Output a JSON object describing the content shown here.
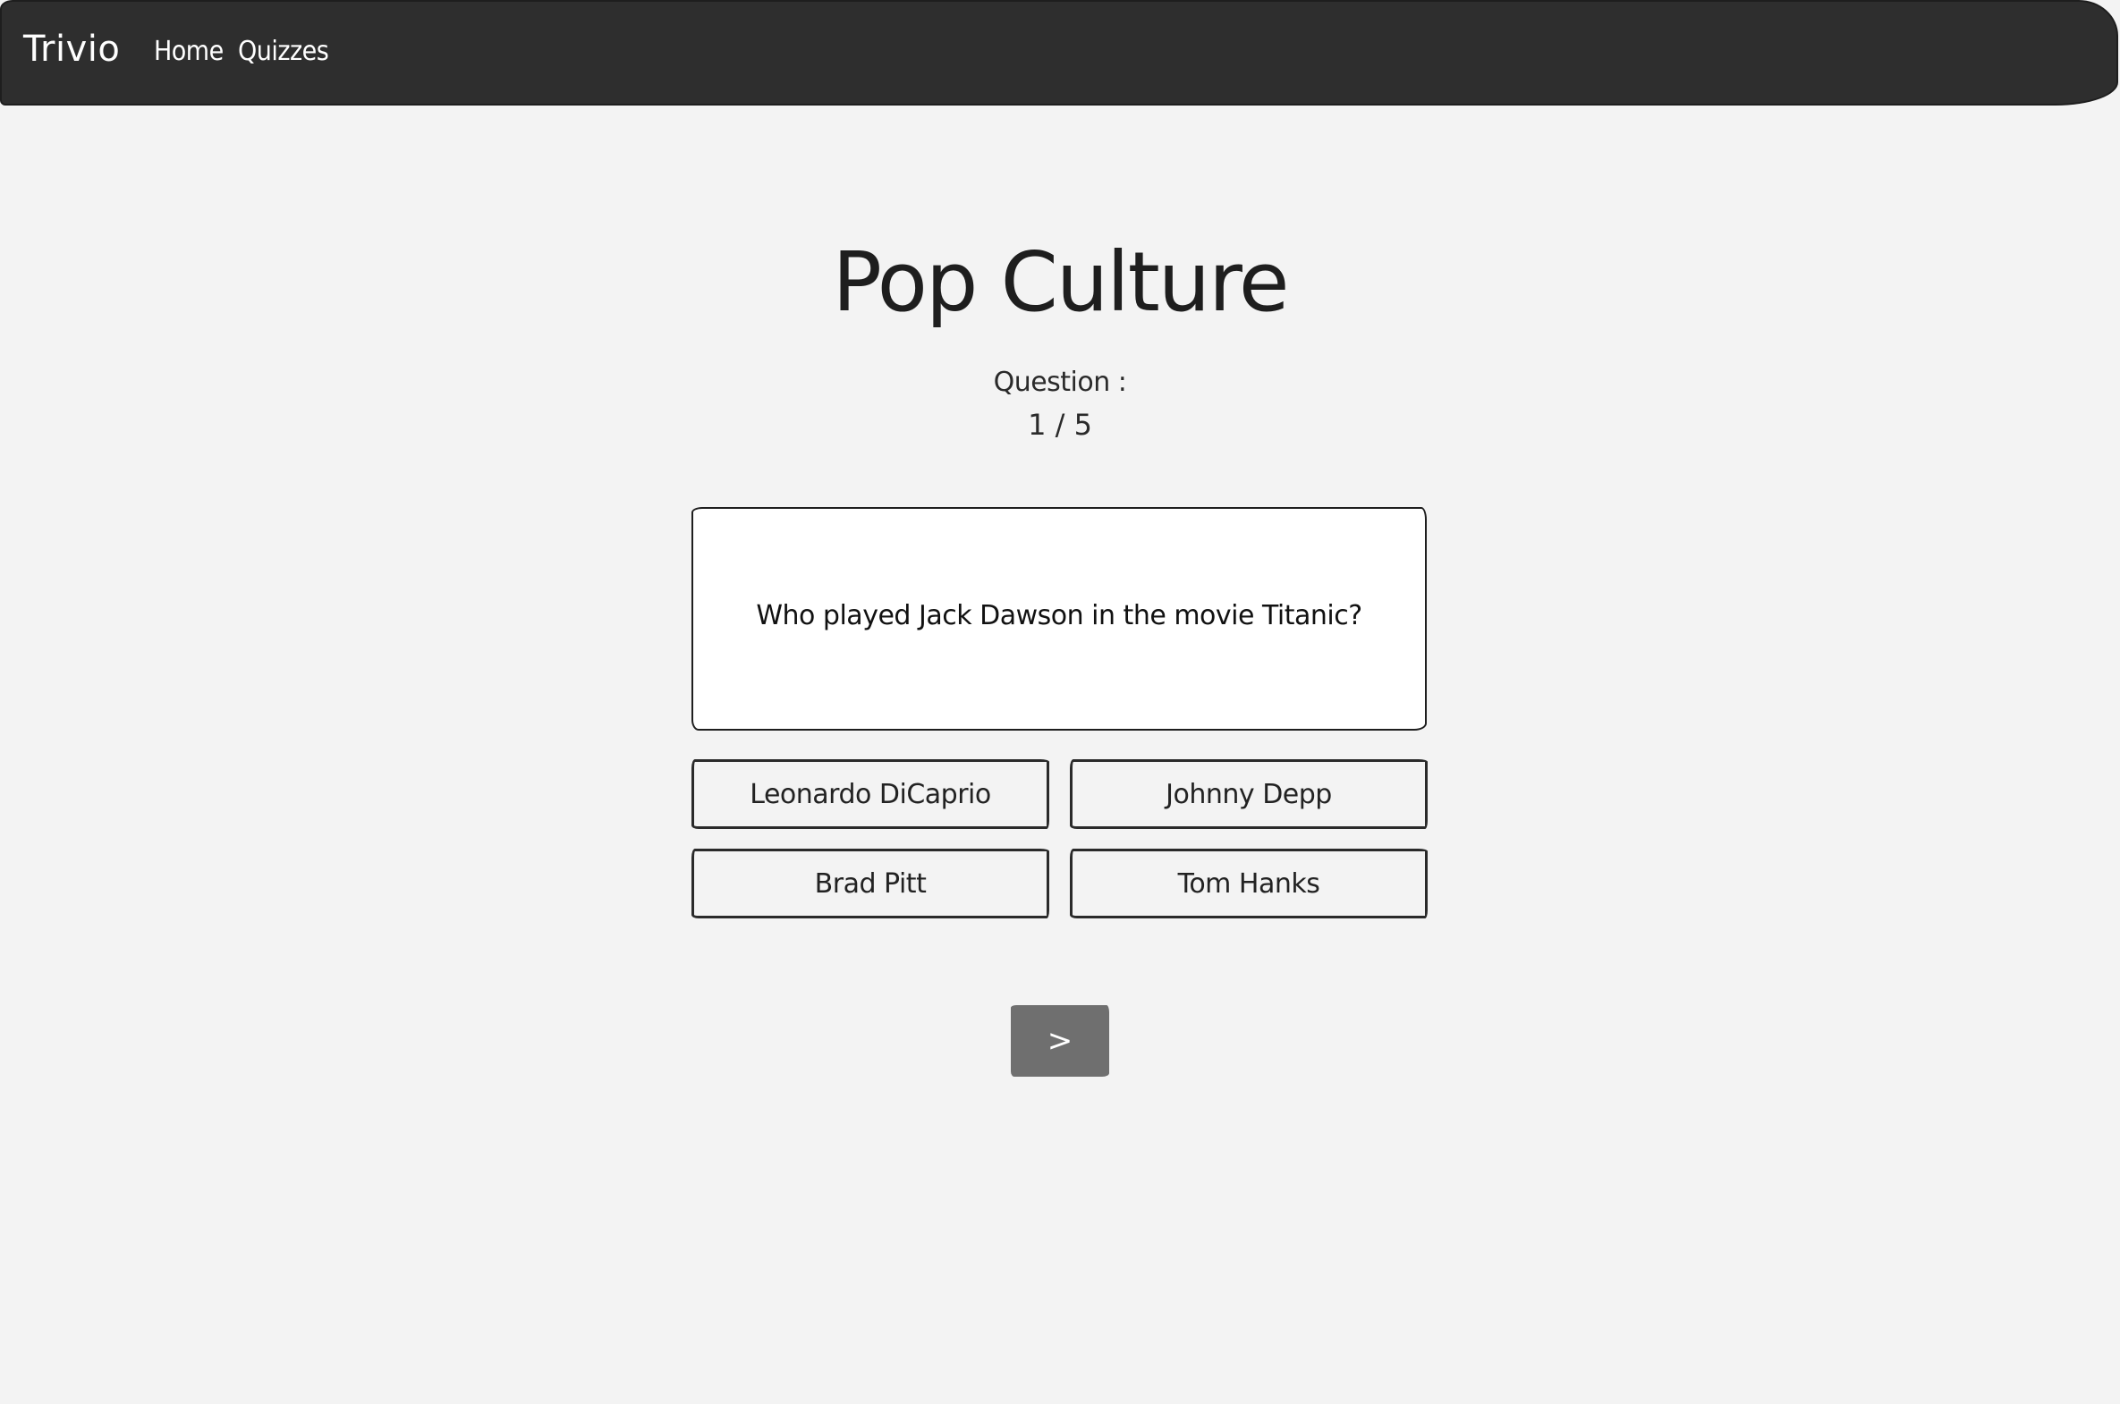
{
  "navbar": {
    "brand": "Trivio",
    "links": [
      {
        "label": "Home"
      },
      {
        "label": "Quizzes"
      }
    ]
  },
  "quiz": {
    "title": "Pop Culture",
    "question_label": "Question :",
    "progress": "1 / 5",
    "progress_current": 1,
    "progress_total": 5,
    "question_text": "Who played Jack Dawson in the movie Titanic?",
    "answers": [
      {
        "label": "Leonardo DiCaprio"
      },
      {
        "label": "Johnny Depp"
      },
      {
        "label": "Brad Pitt"
      },
      {
        "label": "Tom Hanks"
      }
    ],
    "next_label": ">"
  },
  "colors": {
    "background": "#f3f3f3",
    "navbar": "#2e2e2e",
    "next_button": "#6f6f6f",
    "card": "#ffffff",
    "text": "#222222"
  }
}
